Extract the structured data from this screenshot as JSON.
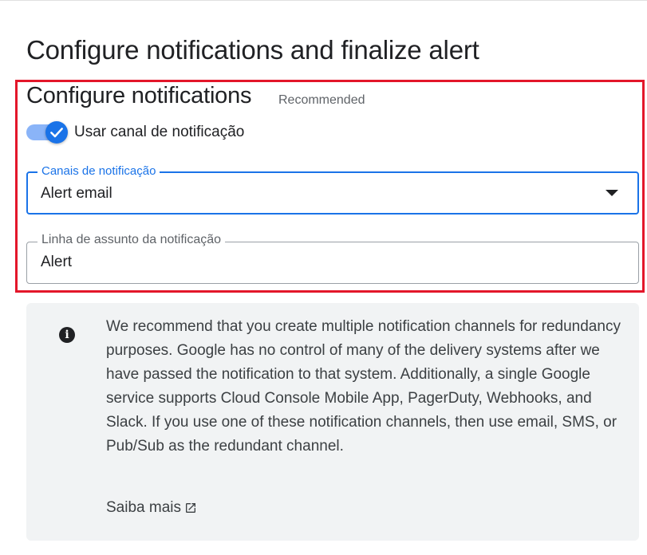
{
  "page": {
    "title": "Configure notifications and finalize alert"
  },
  "notifications": {
    "title": "Configure notifications",
    "badge": "Recommended",
    "use_channel_label": "Usar canal de notificação",
    "use_channel_enabled": true,
    "channels_field": {
      "label": "Canais de notificação",
      "value": "Alert email"
    },
    "subject_field": {
      "label": "Linha de assunto da notificação",
      "value": "Alert"
    }
  },
  "info": {
    "icon": "info-icon",
    "text": "We recommend that you create multiple notification channels for redundancy purposes. Google has no control of many of the delivery systems after we have passed the notification to that system. Additionally, a single Google service supports Cloud Console Mobile App, PagerDuty, Webhooks, and Slack. If you use one of these notification channels, then use email, SMS, or Pub/Sub as the redundant channel.",
    "learn_more": "Saiba mais"
  },
  "colors": {
    "accent": "#1a73e8",
    "highlight": "#e3162a",
    "panel_bg": "#f1f3f4"
  }
}
